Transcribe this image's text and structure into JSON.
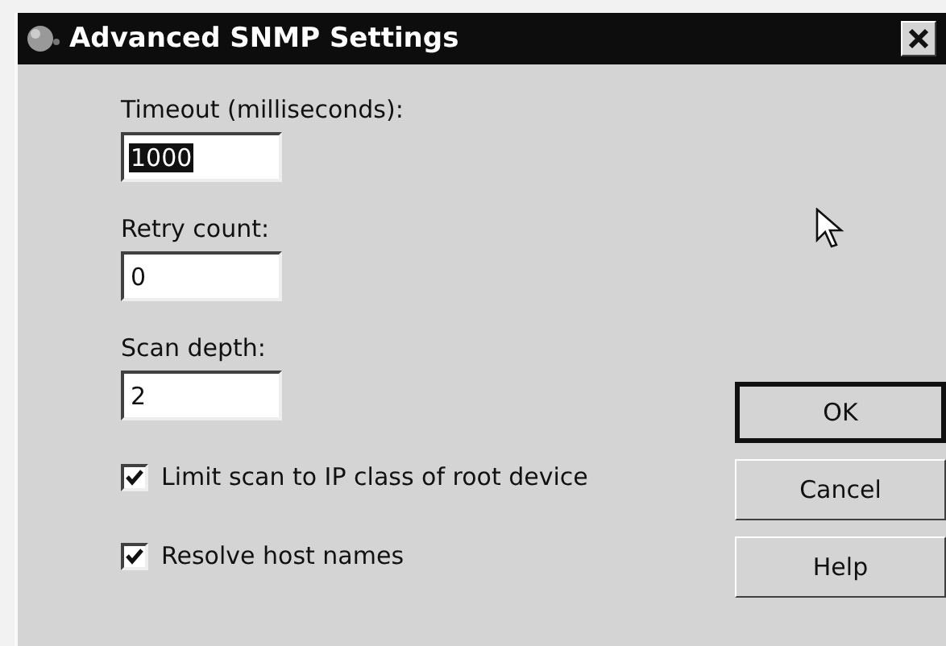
{
  "window": {
    "title": "Advanced SNMP Settings"
  },
  "fields": [
    {
      "label": "Timeout (milliseconds):",
      "value": "1000",
      "text_selected": true
    },
    {
      "label": "Retry count:",
      "value": "0",
      "text_selected": false
    },
    {
      "label": "Scan depth:",
      "value": "2",
      "text_selected": false
    }
  ],
  "checkboxes": [
    {
      "label": "Limit scan to IP class of root device",
      "checked": true
    },
    {
      "label": "Resolve host names",
      "checked": true
    }
  ],
  "buttons": [
    {
      "label": "OK",
      "default": true
    },
    {
      "label": "Cancel",
      "default": false
    },
    {
      "label": "Help",
      "default": false
    }
  ]
}
